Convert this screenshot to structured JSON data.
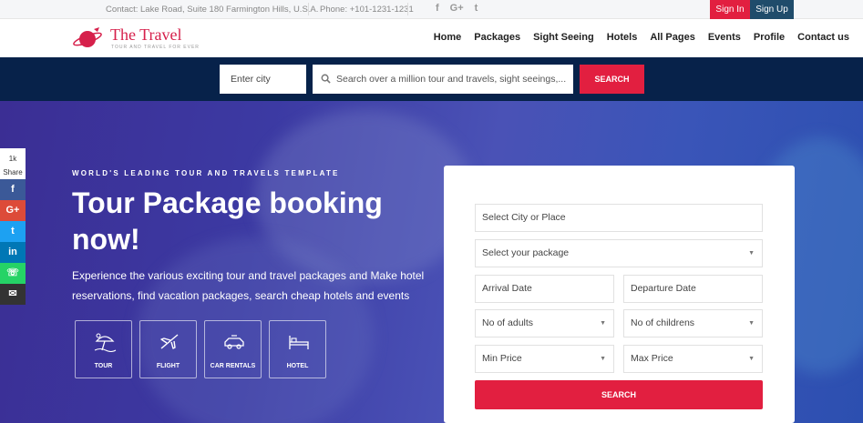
{
  "topbar": {
    "contact": "Contact: Lake Road, Suite 180 Farmington Hills, U.S.A.",
    "phone": "Phone: +101-1231-1231",
    "social": [
      "f",
      "G+",
      "t"
    ],
    "signin": "Sign In",
    "signup": "Sign Up"
  },
  "header": {
    "logo_title": "The Travel",
    "logo_tagline": "TOUR AND TRAVEL FOR EVER",
    "nav": [
      "Home",
      "Packages",
      "Sight Seeing",
      "Hotels",
      "All Pages",
      "Events",
      "Profile",
      "Contact us"
    ]
  },
  "search": {
    "city_placeholder": "Enter city",
    "query_placeholder": "Search over a million tour and travels, sight seeings,...",
    "button": "SEARCH"
  },
  "hero": {
    "eyebrow": "WORLD'S LEADING TOUR AND TRAVELS TEMPLATE",
    "headline": "Tour Package booking now!",
    "description": "Experience the various exciting tour and travel packages and Make hotel reservations, find vacation packages, search cheap hotels and events",
    "services": [
      {
        "label": "TOUR",
        "icon": "beach-umbrella-icon"
      },
      {
        "label": "FLIGHT",
        "icon": "airplane-icon"
      },
      {
        "label": "CAR RENTALS",
        "icon": "car-icon"
      },
      {
        "label": "HOTEL",
        "icon": "bed-icon"
      }
    ]
  },
  "share": {
    "count": "1k",
    "label": "Share",
    "items": [
      {
        "glyph": "f",
        "color": "#3b5998",
        "icon": "facebook-icon"
      },
      {
        "glyph": "G+",
        "color": "#dd4b39",
        "icon": "google-plus-icon"
      },
      {
        "glyph": "t",
        "color": "#1da1f2",
        "icon": "twitter-icon"
      },
      {
        "glyph": "in",
        "color": "#0077b5",
        "icon": "linkedin-icon"
      },
      {
        "glyph": "☏",
        "color": "#25d366",
        "icon": "whatsapp-icon"
      },
      {
        "glyph": "✉",
        "color": "#333333",
        "icon": "email-icon"
      }
    ]
  },
  "form": {
    "city": "Select City or Place",
    "package": "Select your package",
    "arrival": "Arrival Date",
    "departure": "Departure Date",
    "adults": "No of adults",
    "childrens": "No of childrens",
    "min_price": "Min Price",
    "max_price": "Max Price",
    "button": "SEARCH"
  },
  "colors": {
    "accent": "#e21f40",
    "navy": "#07224a",
    "signup": "#1f4c6b"
  }
}
